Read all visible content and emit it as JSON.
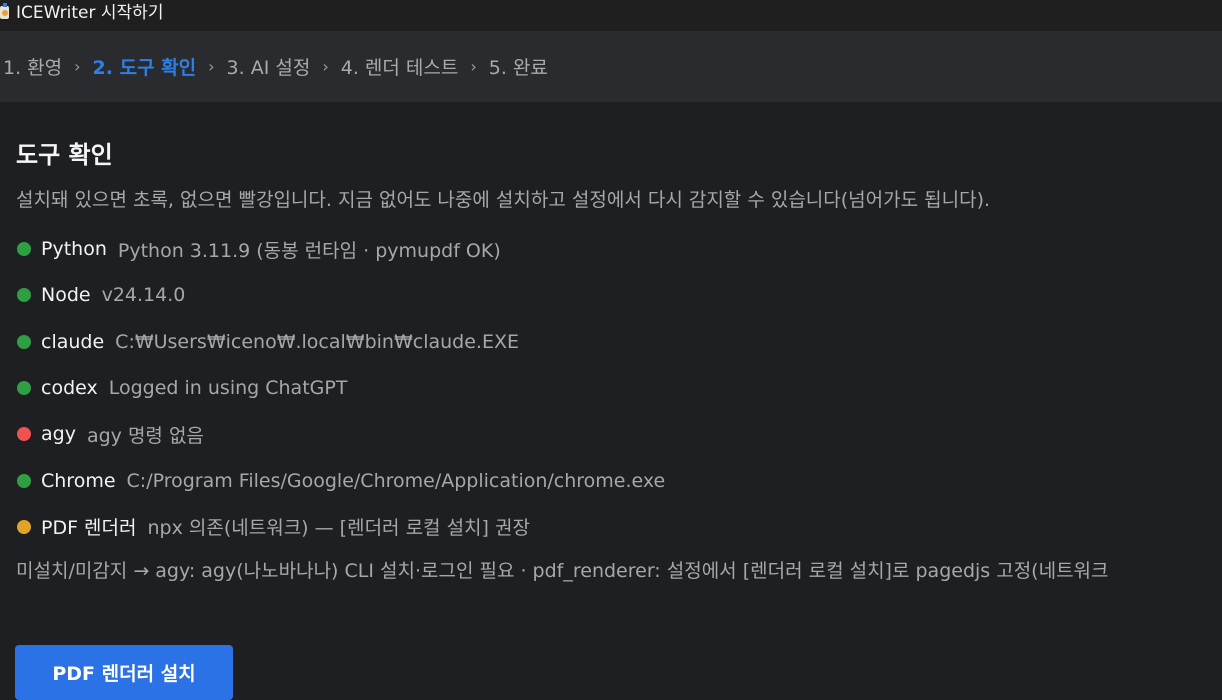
{
  "window": {
    "title": "ICEWriter 시작하기"
  },
  "steps": [
    {
      "label": "1. 환영",
      "active": false
    },
    {
      "label": "2. 도구 확인",
      "active": true
    },
    {
      "label": "3. AI 설정",
      "active": false
    },
    {
      "label": "4. 렌더 테스트",
      "active": false
    },
    {
      "label": "5. 완료",
      "active": false
    }
  ],
  "step_separator": "›",
  "page": {
    "heading": "도구 확인",
    "description": "설치돼 있으면 초록, 없으면 빨강입니다. 지금 없어도 나중에 설치하고 설정에서 다시 감지할 수 있습니다(넘어가도 됩니다)."
  },
  "tools": [
    {
      "name": "Python",
      "detail": "Python 3.11.9 (동봉 런타임 · pymupdf OK)",
      "status": "ok",
      "color": "#2ea043"
    },
    {
      "name": "Node",
      "detail": "v24.14.0",
      "status": "ok",
      "color": "#2ea043"
    },
    {
      "name": "claude",
      "detail": "C:₩Users₩iceno₩.local₩bin₩claude.EXE",
      "status": "ok",
      "color": "#2ea043"
    },
    {
      "name": "codex",
      "detail": "Logged in using ChatGPT",
      "status": "ok",
      "color": "#2ea043"
    },
    {
      "name": "agy",
      "detail": "agy 명령 없음",
      "status": "missing",
      "color": "#f0524f"
    },
    {
      "name": "Chrome",
      "detail": "C:/Program Files/Google/Chrome/Application/chrome.exe",
      "status": "ok",
      "color": "#2ea043"
    },
    {
      "name": "PDF 렌더러",
      "detail": "npx 의존(네트워크) — [렌더러 로컬 설치] 권장",
      "status": "warning",
      "color": "#e0a526"
    }
  ],
  "hint": "미설치/미감지 → agy: agy(나노바나나) CLI 설치·로그인 필요   ·   pdf_renderer: 설정에서 [렌더러 로컬 설치]로 pagedjs 고정(네트워크",
  "buttons": {
    "install_renderer": "PDF 렌더러 설치"
  },
  "colors": {
    "accent": "#2a72e6",
    "active_step": "#2f7fe8",
    "ok": "#2ea043",
    "missing": "#f0524f",
    "warning": "#e0a526"
  }
}
